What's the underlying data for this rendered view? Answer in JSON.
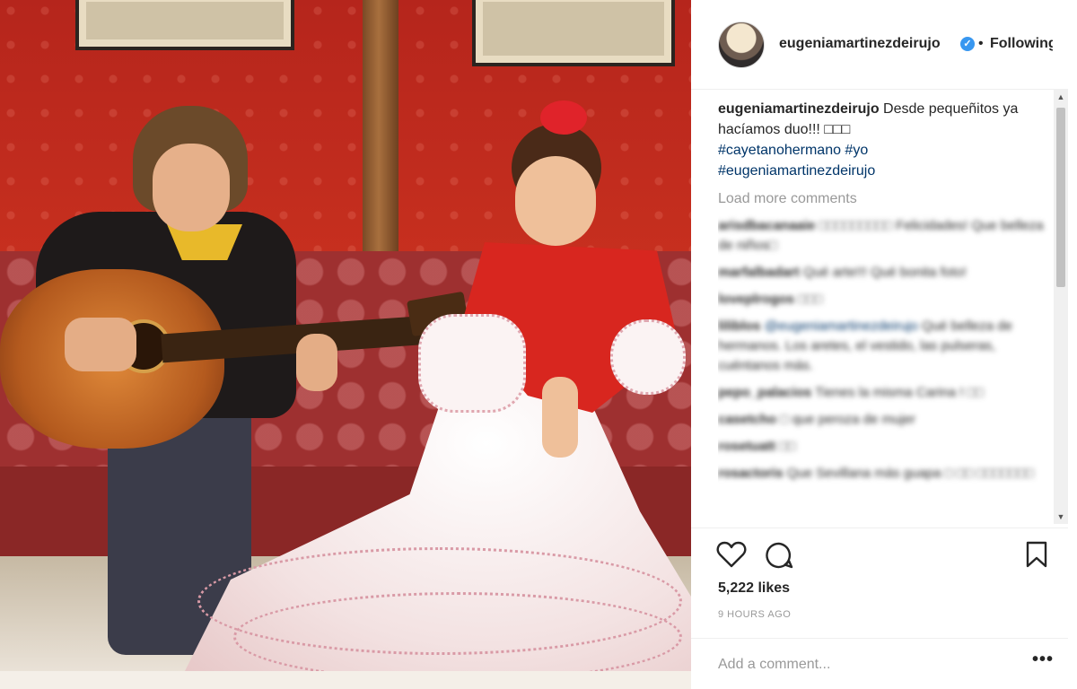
{
  "post": {
    "username": "eugeniamartinezdeirujo",
    "separator": "•",
    "follow_label": "Following",
    "verified_glyph": "✓"
  },
  "caption": {
    "username": "eugeniamartinezdeirujo",
    "text": "Desde pequeñitos ya hacíamos duo!!! □□□",
    "hashtags": [
      "#cayetanohermano #yo",
      "#eugeniamartinezdeirujo"
    ]
  },
  "load_more_label": "Load more comments",
  "comments": [
    {
      "user": "arisdbacanaaie",
      "text": "□□□□□□□□□ Felicidades! Que belleza de niños□",
      "mention": ""
    },
    {
      "user": "marfalbadart",
      "text": "Qué arte!!! Qué bonita foto!",
      "mention": ""
    },
    {
      "user": "loveplrogos",
      "text": "□□□",
      "mention": ""
    },
    {
      "user": "liliblos",
      "text": "Qué belleza de hermanos. Los aretes, el vestido, las pulseras, cuéntanos más.",
      "mention": "@eugeniamartinezdeirujo"
    },
    {
      "user": "pepo_palacios",
      "text": "Tienes la misma Carina ! □□",
      "mention": ""
    },
    {
      "user": "casetcho",
      "text": "□ que peroza de mujer",
      "mention": ""
    },
    {
      "user": "rosetuatt",
      "text": "□□",
      "mention": ""
    },
    {
      "user": "rosactoris",
      "text": "Que Sevillana más guapa □ □□ □□□□□□□",
      "mention": ""
    }
  ],
  "actions": {
    "likes": "5,222 likes",
    "time_ago": "9 HOURS AGO",
    "comment_placeholder": "Add a comment...",
    "more_glyph": "•••"
  },
  "icons": {
    "like": "heart-icon",
    "comment": "comment-bubble-icon",
    "save": "bookmark-icon",
    "scroll_up": "▲",
    "scroll_down": "▼"
  },
  "colors": {
    "link": "#003569",
    "verified": "#3897f0",
    "muted": "#999999"
  }
}
